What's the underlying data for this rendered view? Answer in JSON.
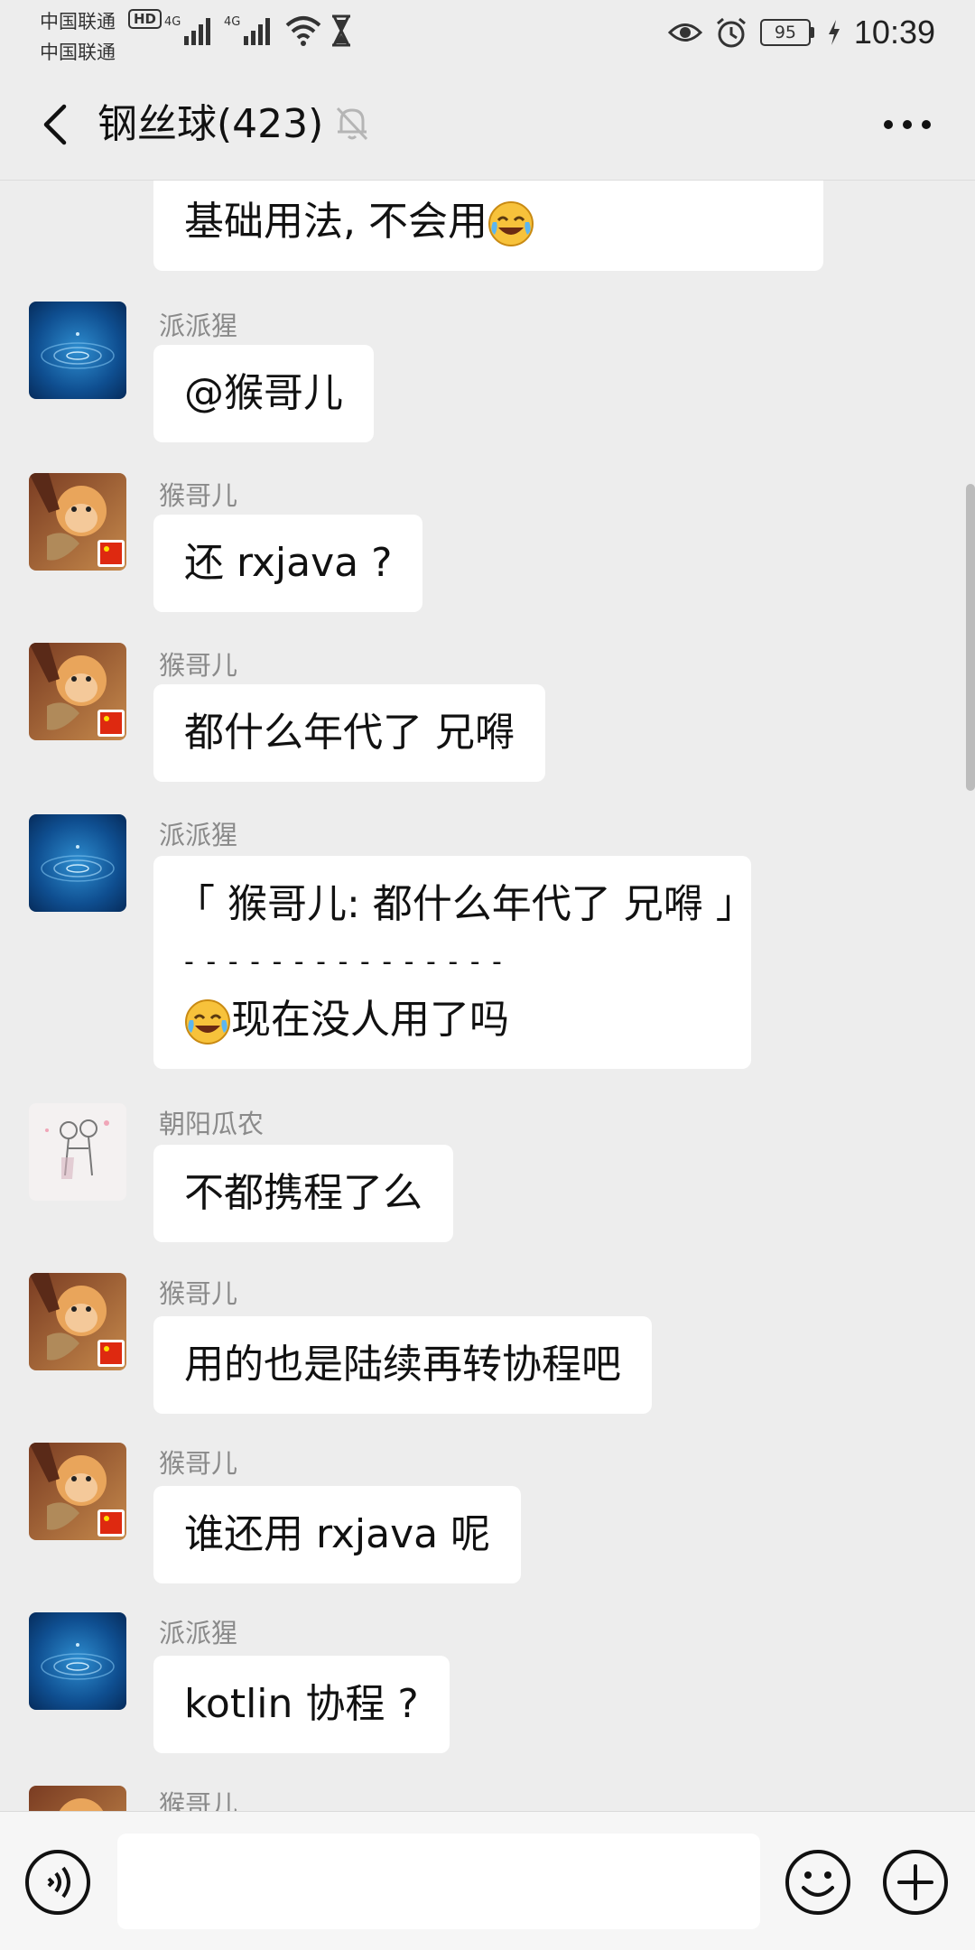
{
  "status_bar": {
    "carrier_1": "中国联通",
    "carrier_2": "中国联通",
    "hd_badge": "HD",
    "network_1": "4G",
    "network_2": "4G",
    "battery": "95",
    "time": "10:39"
  },
  "header": {
    "title": "钢丝球(423)"
  },
  "messages": [
    {
      "sender": "",
      "lines": [
        "基础用法, 不会用"
      ],
      "trailing_emoji": "face-with-tears-of-joy",
      "partial_top": true
    },
    {
      "sender": "派派猩",
      "avatar": "water-drop-avatar",
      "text": "@猴哥儿"
    },
    {
      "sender": "猴哥儿",
      "avatar": "monkey-king-avatar",
      "text": "还 rxjava ?"
    },
    {
      "sender": "猴哥儿",
      "avatar": "monkey-king-avatar",
      "text": "都什么年代了 兄嘚"
    },
    {
      "sender": "派派猩",
      "avatar": "water-drop-avatar",
      "quote": "「 猴哥儿: 都什么年代了 兄嘚 」",
      "divider": "- - - - - - - - - - - - - - -",
      "text": "现在没人用了吗",
      "leading_emoji": "face-with-tears-of-joy"
    },
    {
      "sender": "朝阳瓜农",
      "avatar": "couple-sketch-avatar",
      "text": "不都携程了么"
    },
    {
      "sender": "猴哥儿",
      "avatar": "monkey-king-avatar",
      "text": "用的也是陆续再转协程吧"
    },
    {
      "sender": "猴哥儿",
      "avatar": "monkey-king-avatar",
      "text": "谁还用 rxjava 呢"
    },
    {
      "sender": "派派猩",
      "avatar": "water-drop-avatar",
      "text": "kotlin 协程 ?"
    },
    {
      "sender": "猴哥儿",
      "avatar": "monkey-king-avatar",
      "partial_bottom": true
    }
  ],
  "input_bar": {
    "message_value": "",
    "voice_icon": "voice-icon",
    "emoji_icon": "emoji-icon",
    "plus_icon": "plus-icon"
  },
  "colors": {
    "background": "#ededed",
    "bubble": "#ffffff",
    "sender_name": "#8a8a8a"
  }
}
